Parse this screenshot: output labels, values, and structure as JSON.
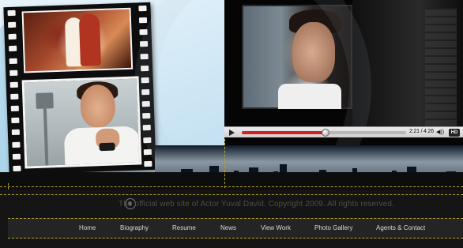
{
  "player": {
    "time": "2:21 / 4:26",
    "volume_icon": "◀))",
    "hd_label": "HD",
    "progress": 0.51
  },
  "footer": {
    "copyright": "The official web site of Actor Yuval David. Copyright 2009. All rights reserved."
  },
  "nav": {
    "items": [
      {
        "label": "Home"
      },
      {
        "label": "Biography"
      },
      {
        "label": "Resume"
      },
      {
        "label": "News"
      },
      {
        "label": "View Work"
      },
      {
        "label": "Photo Gallery"
      },
      {
        "label": "Agents & Contact"
      }
    ]
  },
  "colors": {
    "accent_dash": "#b8a52a",
    "progress_red": "#d42020",
    "nav_bg": "#242424"
  },
  "icons": {
    "play": "play-icon",
    "volume": "volume-icon",
    "logo": "logo-icon"
  }
}
